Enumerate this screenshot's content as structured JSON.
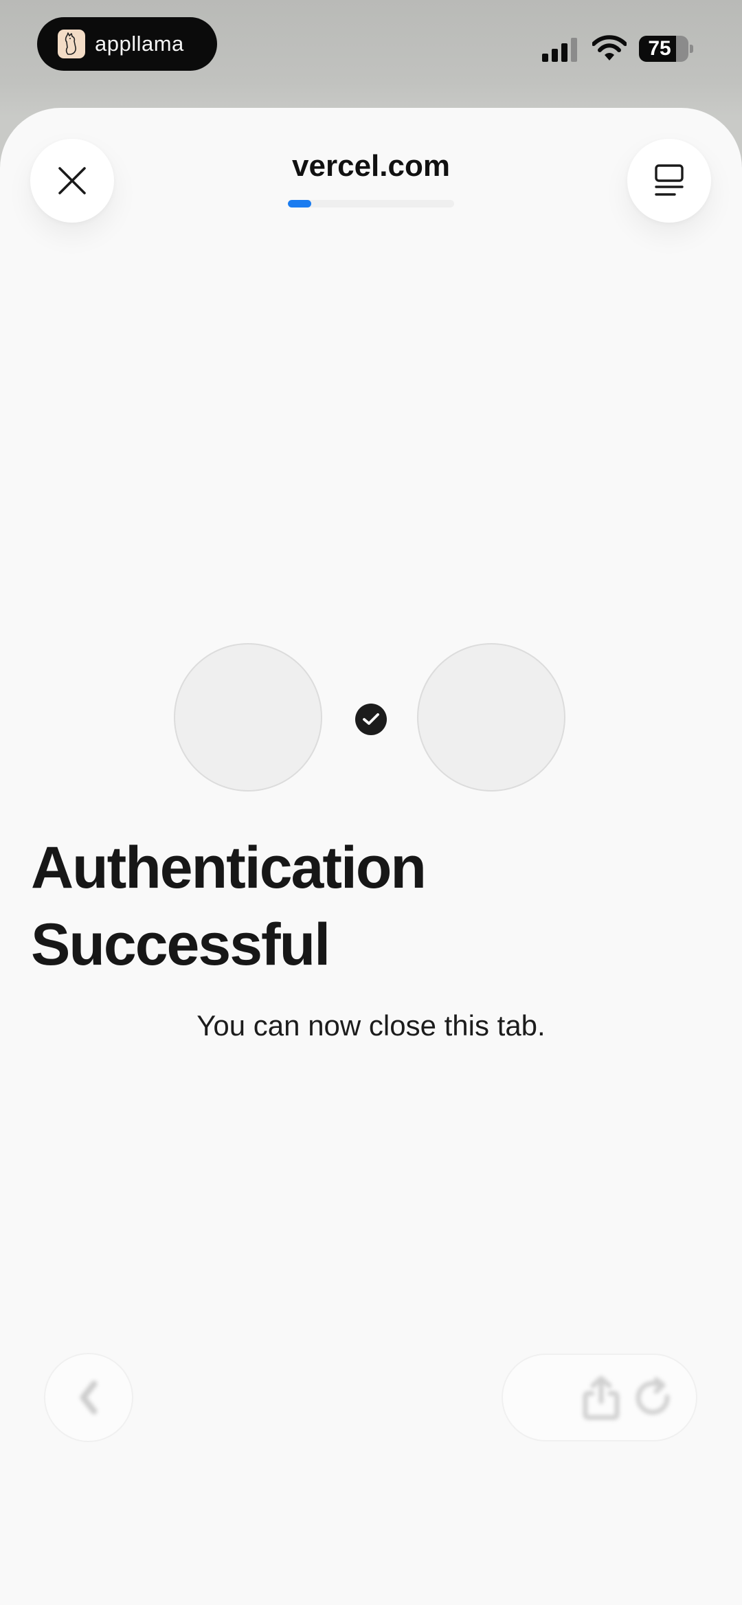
{
  "status_bar": {
    "app_name": "appllama",
    "battery_level": "75",
    "battery_fraction": 0.75
  },
  "browser": {
    "url_title": "vercel.com",
    "load_progress": 0.14
  },
  "content": {
    "headline_line1": "Authentication",
    "headline_line2": "Successful",
    "message": "You can now close this tab."
  },
  "icons": {
    "close": "close-icon",
    "tabs": "tabs-icon",
    "check": "check-icon",
    "back": "chevron-left-icon",
    "share": "share-icon",
    "reload": "reload-icon"
  },
  "colors": {
    "accent": "#1a7cf0",
    "text": "#171717",
    "sheet_background": "#f9f9f9"
  }
}
